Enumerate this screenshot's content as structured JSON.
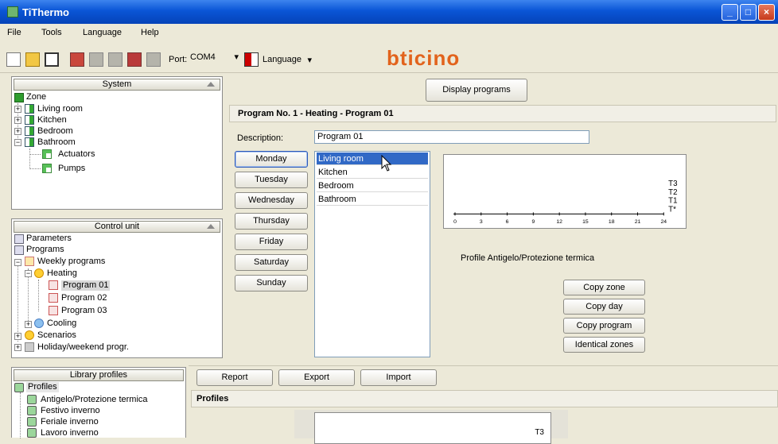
{
  "window": {
    "title": "TiThermo"
  },
  "menu": {
    "file": "File",
    "tools": "Tools",
    "language": "Language",
    "help": "Help"
  },
  "toolbar": {
    "port_label": "Port:",
    "port_value": "COM4",
    "language_label": "Language",
    "brand": "bticino"
  },
  "system_panel": {
    "header": "System",
    "items": {
      "zone": "Zone",
      "living_room": "Living room",
      "kitchen": "Kitchen",
      "bedroom": "Bedroom",
      "bathroom": "Bathroom",
      "actuators": "Actuators",
      "pumps": "Pumps"
    }
  },
  "control_panel": {
    "header": "Control unit",
    "items": {
      "parameters": "Parameters",
      "programs": "Programs",
      "weekly_programs": "Weekly programs",
      "heating": "Heating",
      "program01": "Program 01",
      "program02": "Program 02",
      "program03": "Program 03",
      "cooling": "Cooling",
      "scenarios": "Scenarios",
      "holiday": "Holiday/weekend progr."
    }
  },
  "library_panel": {
    "header": "Library profiles",
    "items": {
      "profiles": "Profiles",
      "antigelo": "Antigelo/Protezione termica",
      "festivo": "Festivo inverno",
      "feriale": "Feriale inverno",
      "lavoro": "Lavoro inverno"
    }
  },
  "main": {
    "display_programs": "Display programs",
    "program_title": "Program No. 1 - Heating - Program 01",
    "description_label": "Description:",
    "description_value": "Program 01",
    "days": [
      "Monday",
      "Tuesday",
      "Wednesday",
      "Thursday",
      "Friday",
      "Saturday",
      "Sunday"
    ],
    "zones": [
      "Living room",
      "Kitchen",
      "Bedroom",
      "Bathroom"
    ],
    "chart_levels": [
      "T3",
      "T2",
      "T1",
      "T*"
    ],
    "chart_ticks": [
      "0",
      "3",
      "6",
      "9",
      "12",
      "15",
      "18",
      "21",
      "24"
    ],
    "profile_text": "Profile  Antigelo/Protezione termica",
    "copy_zone": "Copy zone",
    "copy_day": "Copy day",
    "copy_program": "Copy program",
    "identical_zones": "Identical zones"
  },
  "bottom": {
    "report": "Report",
    "export": "Export",
    "import": "Import",
    "profiles_title": "Profiles",
    "chart_level": "T3"
  },
  "colors": {
    "title_bar": "#0a55d6",
    "selection": "#3169c6"
  }
}
